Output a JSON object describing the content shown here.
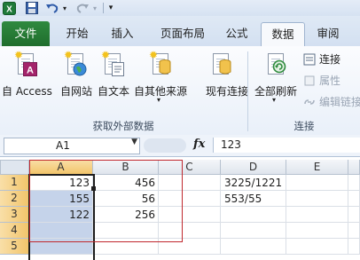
{
  "quick_access": {
    "icons": [
      "excel-icon",
      "save-icon",
      "undo-icon",
      "redo-icon",
      "customize-icon"
    ]
  },
  "tabs": [
    {
      "label": "文件"
    },
    {
      "label": "开始"
    },
    {
      "label": "插入"
    },
    {
      "label": "页面布局"
    },
    {
      "label": "公式"
    },
    {
      "label": "数据"
    },
    {
      "label": "审阅"
    }
  ],
  "ribbon": {
    "get_external": {
      "buttons": [
        {
          "label": "自 Access"
        },
        {
          "label": "自网站"
        },
        {
          "label": "自文本"
        },
        {
          "label": "自其他来源"
        },
        {
          "label": "现有连接"
        }
      ],
      "group_label": "获取外部数据"
    },
    "connections": {
      "refresh_label": "全部刷新",
      "connect_label": "连接",
      "properties_label": "属性",
      "edit_links_label": "编辑链接",
      "group_label": "连接"
    }
  },
  "formula_bar": {
    "name_box": "A1",
    "fx": "fx",
    "formula": "123"
  },
  "columns": [
    "A",
    "B",
    "C",
    "D",
    "E"
  ],
  "rows": [
    "1",
    "2",
    "3",
    "4",
    "5"
  ],
  "cells": {
    "A1": "123",
    "B1": "456",
    "D1": "3225/1221",
    "A2": "155",
    "B2": "56",
    "D2": "553/55",
    "A3": "122",
    "B3": "256"
  },
  "colors": {
    "file_tab": "#217a35",
    "selection": "#c5d3ea",
    "annotation_box": "#c0282e"
  }
}
